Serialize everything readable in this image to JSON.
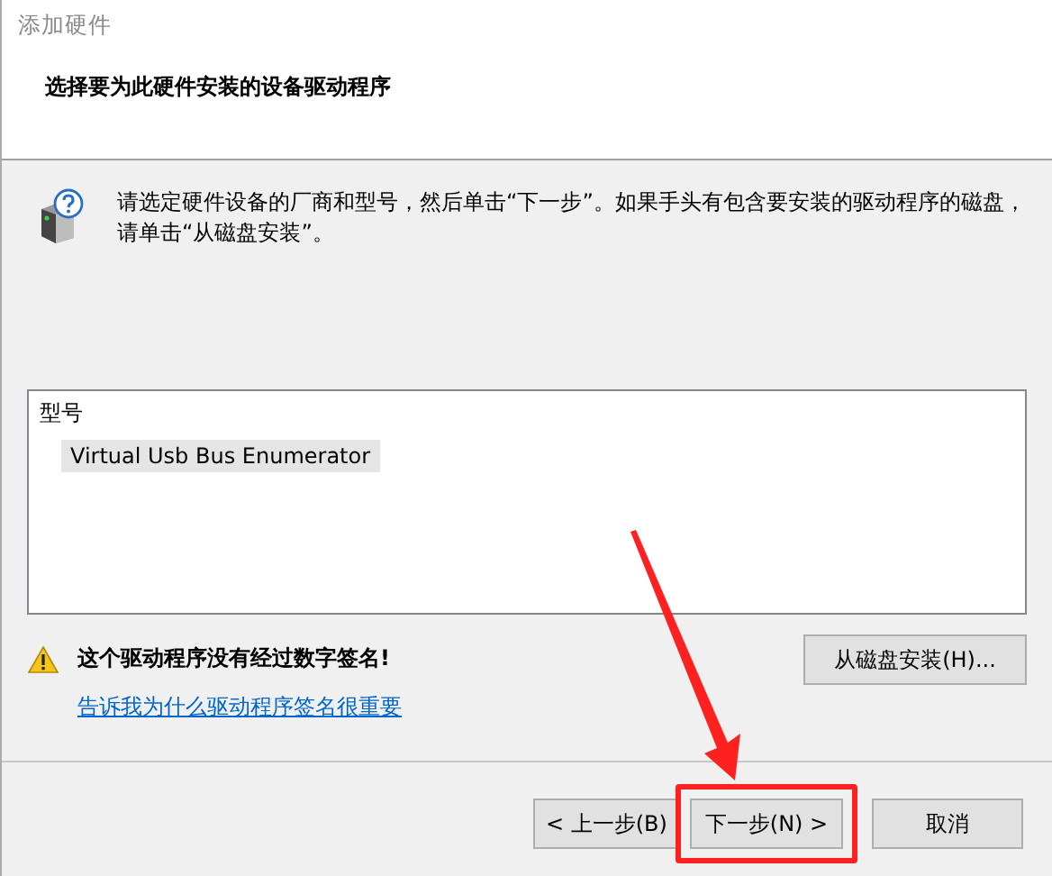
{
  "window": {
    "title": "添加硬件"
  },
  "heading": "选择要为此硬件安装的设备驱动程序",
  "instructions": [
    "请选定硬件设备的厂商和型号，然后单击“下一步”。如果手头有包含要安装的驱动程序的磁盘，",
    "请单击“从磁盘安装”。"
  ],
  "model_list": {
    "header": "型号",
    "items": [
      {
        "label": "Virtual Usb Bus Enumerator",
        "selected": true
      }
    ]
  },
  "warning": {
    "text": "这个驱动程序没有经过数字签名!",
    "link": "告诉我为什么驱动程序签名很重要"
  },
  "have_disk_button": "从磁盘安装(H)...",
  "buttons": [
    {
      "label": "< 上一步(B)",
      "highlighted": false
    },
    {
      "label": "下一步(N) >",
      "highlighted": true
    },
    {
      "label": "取消",
      "highlighted": false
    }
  ]
}
